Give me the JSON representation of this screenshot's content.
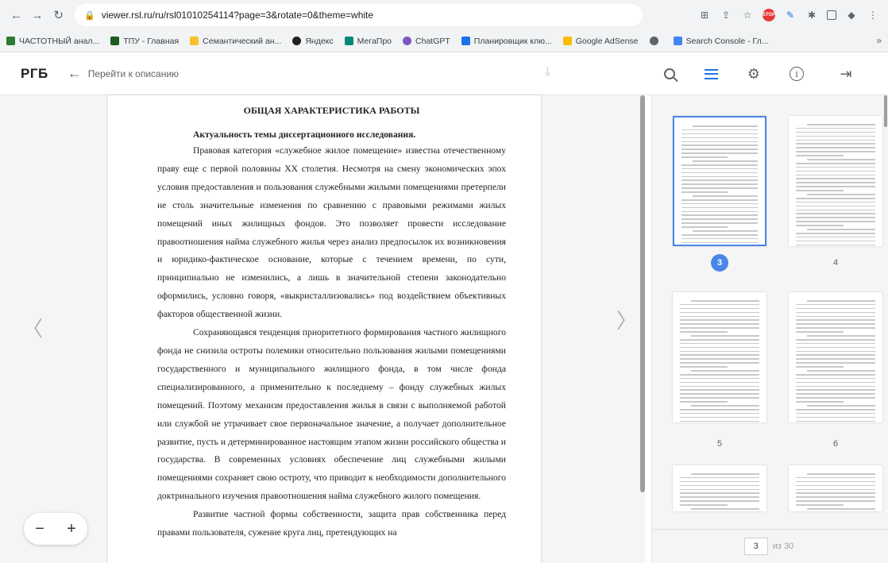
{
  "browser": {
    "url": "viewer.rsl.ru/ru/rsl01010254114?page=3&rotate=0&theme=white",
    "bookmarks": [
      {
        "label": "ЧАСТОТНЫЙ анал...",
        "color": "#2e7d32"
      },
      {
        "label": "ТПУ - Главная",
        "color": "#1b5e20"
      },
      {
        "label": "Семантический ан...",
        "color": "#fbc02d"
      },
      {
        "label": "Яндекс",
        "color": "#212121"
      },
      {
        "label": "МегаПро",
        "color": "#00897b"
      },
      {
        "label": "ChatGPT",
        "color": "#7e57c2"
      },
      {
        "label": "Планировщик клю...",
        "color": "#1a73e8"
      },
      {
        "label": "Google AdSense",
        "color": "#fbbc04"
      },
      {
        "label": "",
        "color": "#5f6368"
      },
      {
        "label": "Search Console - Гл...",
        "color": "#4285f4"
      }
    ],
    "more": "»"
  },
  "viewer": {
    "logo": "РГБ",
    "back_label": "Перейти к описанию"
  },
  "page": {
    "heading": "ОБЩАЯ ХАРАКТЕРИСТИКА РАБОТЫ",
    "subheading": "Актуальность темы диссертационного исследования.",
    "paragraphs": [
      "Правовая категория «служебное жилое помещение» известна отечественному праву еще с первой половины XX столетия. Несмотря на смену экономических эпох условия предоставления и пользования служебными жилыми помещениями претерпели не столь значительные изменения по сравнению с правовыми режимами жилых помещений иных жилищных фондов. Это позволяет провести исследование правоотношения найма служебного жилья через анализ предпосылок их возникновения и юридико-фактическое основание, которые с течением времени, по сути, принципиально не изменились, а лишь в значительной степени законодательно оформились, условно говоря, «выкристаллизовались» под воздействием объективных факторов общественной жизни.",
      "Сохраняющаяся тенденция приоритетного формирования частного жилищного фонда не снизила остроты полемики относительно пользования жилыми помещениями государственного и муниципального жилищного фонда, в том числе фонда специализированного, а применительно к последнему – фонду служебных жилых помещений. Поэтому механизм предоставления жилья в связи с выполняемой работой или службой не утрачивает свое первоначальное значение, а получает дополнительное развитие, пусть и детерминированное настоящим этапом жизни российского общества и государства. В современных условиях обеспечение лиц служебными жилыми помещениями сохраняет свою остроту, что приводит к необходимости дополнительного доктринального изучения правоотношения найма служебного жилого помещения.",
      "Развитие частной формы собственности, защита прав собственника перед правами пользователя, сужение круга лиц, претендующих на"
    ]
  },
  "thumbnails": [
    {
      "num": "3",
      "active": true
    },
    {
      "num": "4",
      "active": false
    },
    {
      "num": "5",
      "active": false
    },
    {
      "num": "6",
      "active": false
    },
    {
      "num": "",
      "active": false
    },
    {
      "num": "",
      "active": false
    }
  ],
  "pager": {
    "current": "3",
    "total_label": "из 30"
  },
  "zoom": {
    "minus": "−",
    "plus": "+"
  }
}
